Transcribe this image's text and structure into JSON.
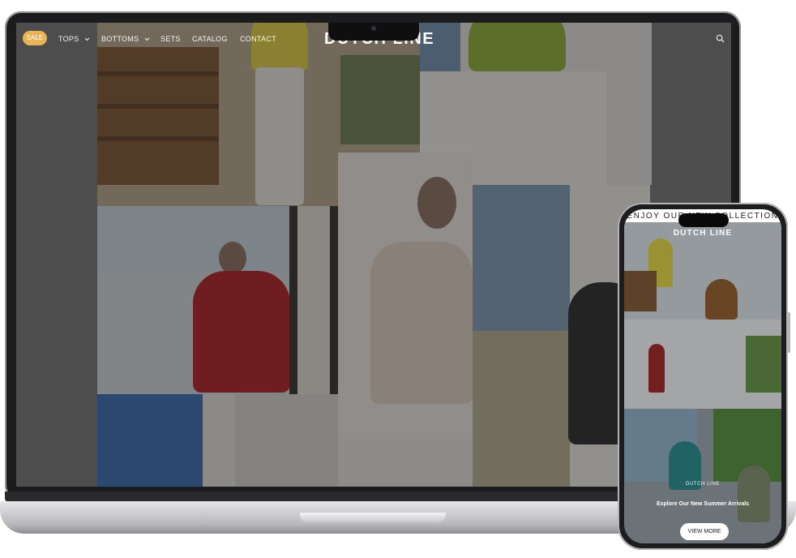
{
  "desktop": {
    "nav": {
      "sale_label": "SALE",
      "tops_label": "TOPS",
      "bottoms_label": "BOTTOMS",
      "sets_label": "SETS",
      "catalog_label": "CATALOG",
      "contact_label": "CONTACT"
    },
    "brand": "DUTCH LINE",
    "icons": {
      "search": "search-icon",
      "dropdown": "chevron-down-icon"
    }
  },
  "mobile": {
    "marquee": "ENJOY OUR NEW COLLECTION",
    "brand": "DUTCH LINE",
    "caption_brand": "DUTCH LINE",
    "headline": "Explore Our New Summer Arrivals",
    "cta_label": "VIEW MORE"
  },
  "colors": {
    "accent_sale": "#e8b455",
    "overlay": "#4d4d4d"
  }
}
